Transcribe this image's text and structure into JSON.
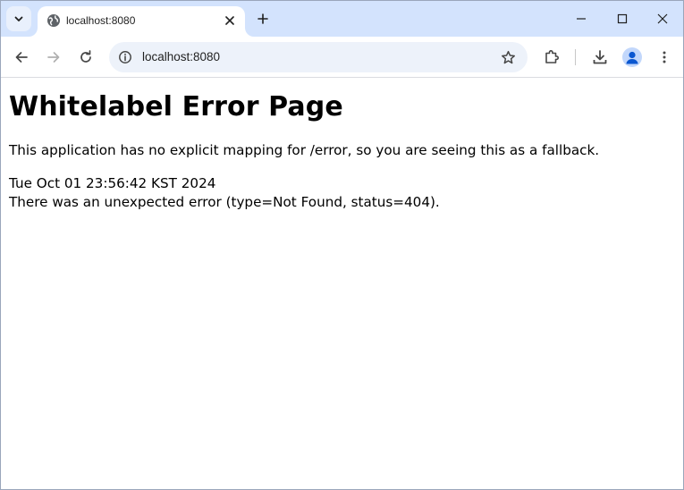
{
  "browser": {
    "tab": {
      "title": "localhost:8080"
    },
    "address_bar": {
      "url": "localhost:8080"
    }
  },
  "page": {
    "title": "Whitelabel Error Page",
    "message": "This application has no explicit mapping for /error, so you are seeing this as a fallback.",
    "timestamp": "Tue Oct 01 23:56:42 KST 2024",
    "error_detail": "There was an unexpected error (type=Not Found, status=404)."
  },
  "colors": {
    "tabstrip_bg": "#d3e3fd",
    "omnibox_bg": "#edf2fa",
    "avatar_blue": "#0b57d0"
  },
  "icons": [
    "chevron-down-icon",
    "globe-icon",
    "close-icon",
    "plus-icon",
    "minimize-icon",
    "maximize-icon",
    "back-arrow-icon",
    "forward-arrow-icon",
    "reload-icon",
    "info-icon",
    "star-icon",
    "extensions-icon",
    "download-icon",
    "profile-icon",
    "more-vert-icon"
  ]
}
